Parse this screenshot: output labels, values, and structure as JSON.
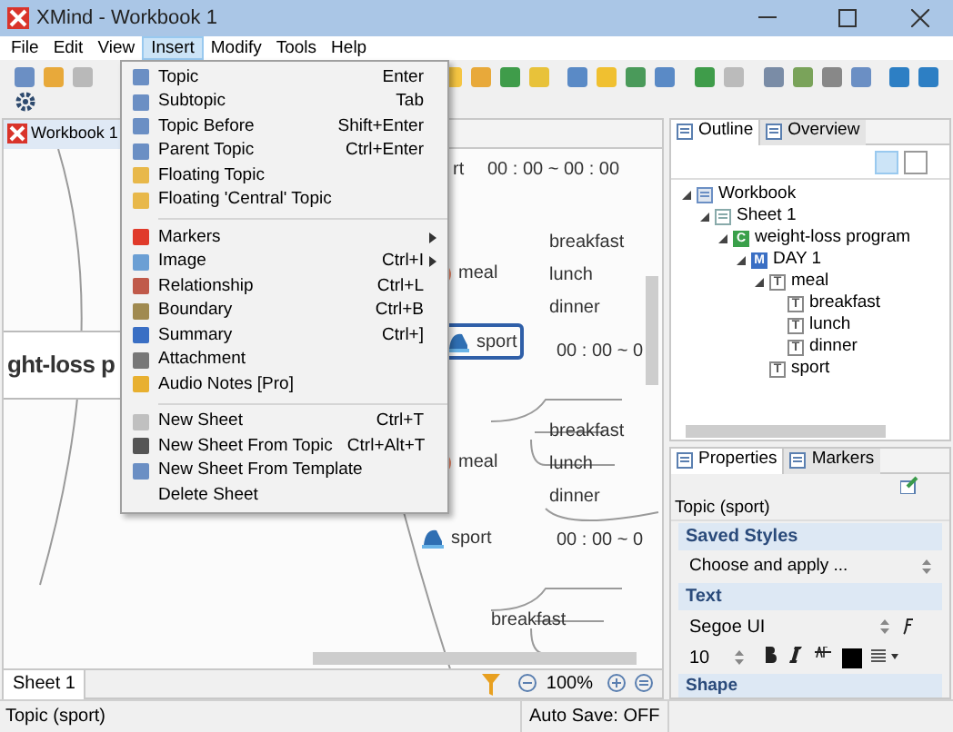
{
  "window": {
    "title": "XMind - Workbook 1"
  },
  "menu_bar": [
    {
      "label": "File",
      "selected": false
    },
    {
      "label": "Edit",
      "selected": false
    },
    {
      "label": "View",
      "selected": false
    },
    {
      "label": "Insert",
      "selected": true
    },
    {
      "label": "Modify",
      "selected": false
    },
    {
      "label": "Tools",
      "selected": false
    },
    {
      "label": "Help",
      "selected": false
    }
  ],
  "insert_menu": [
    {
      "kind": "item",
      "label": "Topic",
      "shortcut": "Enter",
      "submenu": false
    },
    {
      "kind": "item",
      "label": "Subtopic",
      "shortcut": "Tab",
      "submenu": false
    },
    {
      "kind": "item",
      "label": "Topic Before",
      "shortcut": "Shift+Enter",
      "submenu": false
    },
    {
      "kind": "item",
      "label": "Parent Topic",
      "shortcut": "Ctrl+Enter",
      "submenu": false
    },
    {
      "kind": "item",
      "label": "Floating Topic",
      "submenu": false
    },
    {
      "kind": "item",
      "label": "Floating 'Central' Topic",
      "submenu": false
    },
    {
      "kind": "separator"
    },
    {
      "kind": "item",
      "label": "Markers",
      "submenu": true
    },
    {
      "kind": "item",
      "label": "Image",
      "shortcut": "Ctrl+I",
      "submenu": true
    },
    {
      "kind": "item",
      "label": "Relationship",
      "shortcut": "Ctrl+L",
      "submenu": false
    },
    {
      "kind": "item",
      "label": "Boundary",
      "shortcut": "Ctrl+B",
      "submenu": false
    },
    {
      "kind": "item",
      "label": "Summary",
      "shortcut": "Ctrl+]",
      "submenu": false
    },
    {
      "kind": "item",
      "label": "Attachment",
      "submenu": false
    },
    {
      "kind": "item",
      "label": "Audio Notes [Pro]",
      "submenu": false
    },
    {
      "kind": "separator"
    },
    {
      "kind": "item",
      "label": "New Sheet",
      "shortcut": "Ctrl+T",
      "submenu": false
    },
    {
      "kind": "item",
      "label": "New Sheet From Topic",
      "shortcut": "Ctrl+Alt+T",
      "submenu": false
    },
    {
      "kind": "item",
      "label": "New Sheet From Template",
      "submenu": false
    },
    {
      "kind": "item",
      "label": "Delete Sheet",
      "submenu": false
    }
  ],
  "editor": {
    "tab": "Workbook 1",
    "central_topic": "ght-loss p",
    "nodes": [
      {
        "kind": "text",
        "label": "rt"
      },
      {
        "kind": "time",
        "label": "00 : 00 ~ 00 : 00"
      },
      {
        "kind": "meal",
        "label": "meal"
      },
      {
        "kind": "leaf",
        "label": "breakfast"
      },
      {
        "kind": "leaf",
        "label": "lunch"
      },
      {
        "kind": "leaf",
        "label": "dinner"
      },
      {
        "kind": "sport",
        "label": "sport",
        "selected": true
      },
      {
        "kind": "time",
        "label": "00 : 00 ~ 0"
      },
      {
        "kind": "meal",
        "label": "meal"
      },
      {
        "kind": "leaf",
        "label": "breakfast"
      },
      {
        "kind": "leaf",
        "label": "lunch"
      },
      {
        "kind": "leaf",
        "label": "dinner"
      },
      {
        "kind": "sport",
        "label": "sport",
        "selected": false
      },
      {
        "kind": "time",
        "label": "00 : 00 ~ 0"
      },
      {
        "kind": "leaf",
        "label": "breakfast"
      }
    ],
    "sheet_tabs": [
      {
        "label": "Sheet 1",
        "selected": true
      }
    ],
    "zoom": "100%"
  },
  "outline": {
    "tabs": [
      {
        "label": "Outline",
        "selected": true
      },
      {
        "label": "Overview",
        "selected": false
      }
    ],
    "tree": [
      {
        "label": "Workbook",
        "kind": "workbook",
        "children": [
          {
            "label": "Sheet 1",
            "kind": "sheet",
            "children": [
              {
                "label": "weight-loss program",
                "kind": "central",
                "badge": "C",
                "children": [
                  {
                    "label": "DAY 1",
                    "kind": "main",
                    "badge": "M",
                    "children": [
                      {
                        "label": "meal",
                        "kind": "topic",
                        "badge": "T",
                        "children": [
                          {
                            "label": "breakfast",
                            "kind": "topic",
                            "badge": "T"
                          },
                          {
                            "label": "lunch",
                            "kind": "topic",
                            "badge": "T"
                          },
                          {
                            "label": "dinner",
                            "kind": "topic",
                            "badge": "T"
                          }
                        ]
                      },
                      {
                        "label": "sport",
                        "kind": "topic",
                        "badge": "T"
                      }
                    ]
                  }
                ]
              }
            ]
          }
        ]
      }
    ]
  },
  "properties": {
    "tabs": [
      {
        "label": "Properties",
        "selected": true
      },
      {
        "label": "Markers",
        "selected": false
      }
    ],
    "topic": "Topic (sport)",
    "saved_styles": {
      "title": "Saved Styles",
      "value": "Choose and apply ..."
    },
    "text": {
      "title": "Text",
      "font": "Segoe UI",
      "size": "10",
      "color": "#000000"
    },
    "next_section": "Shape"
  },
  "status_bar": {
    "selection": "Topic (sport)",
    "auto_save": "Auto Save: OFF"
  }
}
